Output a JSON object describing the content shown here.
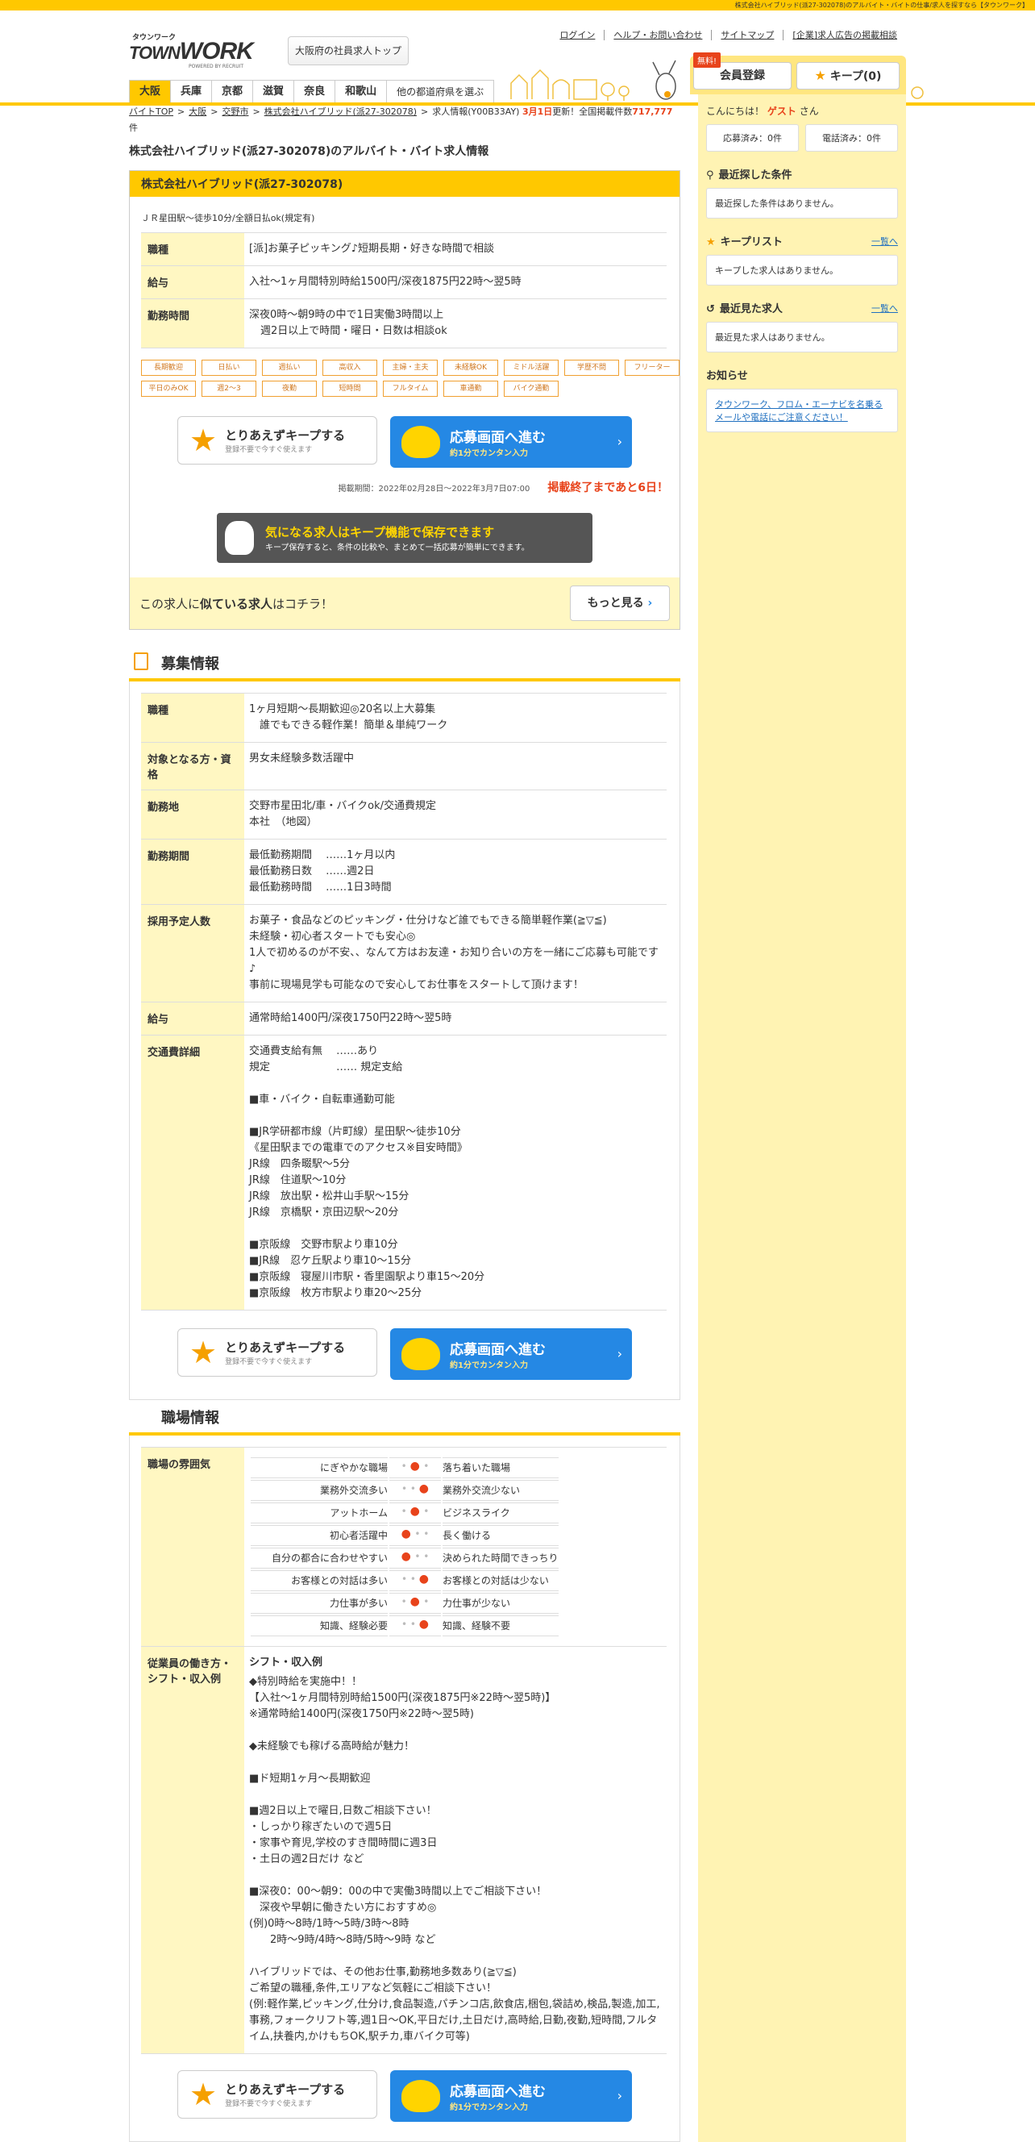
{
  "topbar_text": "株式会社ハイブリッド(派27-302078)のアルバイト・バイトの仕事/求人を探すなら【タウンワーク】",
  "logo": {
    "kana": "タウンワーク",
    "word_town": "TOWN",
    "word_work": "WORK",
    "by": "POWERED BY RECRUIT"
  },
  "osaka_top": "大阪府の社員求人トップ",
  "header_links": [
    "ログイン",
    "ヘルプ・お問い合わせ",
    "サイトマップ",
    "[企業]求人広告の掲載相談"
  ],
  "regions": [
    "大阪",
    "兵庫",
    "京都",
    "滋賀",
    "奈良",
    "和歌山"
  ],
  "regions_other": "他の都道府県を選ぶ",
  "free_badge": "無料!",
  "member_btn": "会員登録",
  "keep_btn": "キープ(0)",
  "breadcrumb": {
    "items": [
      "バイトTOP",
      "大阪",
      "交野市",
      "株式会社ハイブリッド(派27-302078)"
    ],
    "tail": "求人情報(Y00B33AY)",
    "updated": "3月1日",
    "updated_suffix": "更新！全国掲載件数",
    "count": "717,777",
    "count_unit": "件"
  },
  "page_title": "株式会社ハイブリッド(派27-302078)のアルバイト・バイト求人情報",
  "summary": {
    "head": "株式会社ハイブリッド(派27-302078)",
    "note": "ＪＲ星田駅～徒歩10分/全額日払ok(規定有)",
    "rows": [
      {
        "label": "職種",
        "value": "[派]お菓子ピッキング♪短期長期・好きな時間で相談"
      },
      {
        "label": "給与",
        "value": "入社～1ヶ月間特別時給1500円/深夜1875円22時～翌5時"
      },
      {
        "label": "勤務時間",
        "value": "深夜0時～朝9時の中で1日実働3時間以上",
        "value2": "週2日以上で時間・曜日・日数は相談ok"
      }
    ],
    "tags": [
      "長期歓迎",
      "日払い",
      "週払い",
      "高収入",
      "主婦・主夫",
      "未経験OK",
      "ミドル活躍",
      "学歴不問",
      "フリーター",
      "平日のみOK",
      "週2～3",
      "夜勤",
      "短時間",
      "フルタイム",
      "車通勤",
      "バイク通勤"
    ],
    "period": "掲載期間：2022年02月28日～2022年3月7日07:00",
    "deadline": "掲載終了まであと6日！"
  },
  "keep_action": {
    "t1": "とりあえずキープする",
    "t2": "登録不要で今すぐ使えます"
  },
  "apply_action": {
    "t1": "応募画面へ進む",
    "t2": "約1分でカンタン入力"
  },
  "banner": {
    "t1": "気になる求人はキープ機能で保存できます",
    "t2": "キープ保存すると、条件の比較や、まとめて一括応募が簡単にできます。"
  },
  "similar": {
    "pre": "この求人に",
    "bold": "似ている求人",
    "post": "はコチラ！",
    "more": "もっと見る"
  },
  "recruit": {
    "title": "募集情報",
    "rows": [
      {
        "label": "職種",
        "lines": [
          "1ヶ月短期～長期歓迎◎20名以上大募集",
          "　誰でもできる軽作業！簡単＆単純ワーク"
        ]
      },
      {
        "label": "対象となる方・資格",
        "lines": [
          "男女未経験多数活躍中"
        ]
      },
      {
        "label": "勤務地",
        "lines": [
          "交野市星田北/車・バイクok/交通費規定",
          "本社　（地図）"
        ]
      },
      {
        "label": "勤務期間",
        "lines": [
          "最低勤務期間　 ……1ヶ月以内",
          "最低勤務日数　 ……週2日",
          "最低勤務時間　 ……1日3時間"
        ]
      },
      {
        "label": "採用予定人数",
        "lines": [
          "お菓子・食品などのピッキング・仕分けなど誰でもできる簡単軽作業(≧▽≦)",
          "未経験・初心者スタートでも安心◎",
          "1人で初めるのが不安、、なんて方はお友達・お知り合いの方を一緒にご応募も可能です♪",
          "事前に現場見学も可能なので安心してお仕事をスタートして頂けます！"
        ]
      },
      {
        "label": "給与",
        "lines": [
          "通常時給1400円/深夜1750円22時～翌5時"
        ]
      },
      {
        "label": "交通費詳細",
        "lines": [
          "交通費支給有無　 ……あり",
          "規定　　　　　　 …… 規定支給",
          "",
          "■車・バイク・自転車通勤可能",
          "",
          "■JR学研都市線（片町線）星田駅～徒歩10分",
          "《星田駅までの電車でのアクセス※目安時間》",
          "JR線　四条畷駅～5分",
          "JR線　住道駅～10分",
          "JR線　放出駅・松井山手駅～15分",
          "JR線　京橋駅・京田辺駅～20分",
          "",
          "■京阪線　交野市駅より車10分",
          "■JR線　忍ケ丘駅より車10～15分",
          "■京阪線　寝屋川市駅・香里園駅より車15～20分",
          "■京阪線　枚方市駅より車20～25分"
        ]
      }
    ]
  },
  "workplace": {
    "title": "職場情報",
    "atmosphere_label": "職場の雰囲気",
    "atmosphere": [
      {
        "left": "にぎやかな職場",
        "right": "落ち着いた職場",
        "pos": 1
      },
      {
        "left": "業務外交流多い",
        "right": "業務外交流少ない",
        "pos": 2
      },
      {
        "left": "アットホーム",
        "right": "ビジネスライク",
        "pos": 1
      },
      {
        "left": "初心者活躍中",
        "right": "長く働ける",
        "pos": 0
      },
      {
        "left": "自分の都合に合わせやすい",
        "right": "決められた時間できっちり",
        "pos": 0
      },
      {
        "left": "お客様との対話は多い",
        "right": "お客様との対話は少ない",
        "pos": 2
      },
      {
        "left": "力仕事が多い",
        "right": "力仕事が少ない",
        "pos": 1
      },
      {
        "left": "知識、経験必要",
        "right": "知識、経験不要",
        "pos": 2
      }
    ],
    "shift_label": "従業員の働き方・シフト・収入例",
    "shift_title": "シフト・収入例",
    "shift_lines": [
      "◆特別時給を実施中！！",
      "【入社～1ヶ月間特別時給1500円(深夜1875円※22時～翌5時)】",
      "※通常時給1400円(深夜1750円※22時～翌5時)",
      "",
      "◆未経験でも稼げる高時給が魅力！",
      "",
      "■ド短期1ヶ月～長期歓迎",
      "",
      "■週2日以上で曜日,日数ご相談下さい！",
      "・しっかり稼ぎたいので週5日",
      "・家事や育児,学校のすき間時間に週3日",
      "・土日の週2日だけ など",
      "",
      "■深夜0：00～朝9：00の中で実働3時間以上でご相談下さい！",
      "　深夜や早朝に働きたい方におすすめ◎",
      "(例)0時～8時/1時～5時/3時～8時",
      "　　2時～9時/4時～8時/5時～9時 など",
      "",
      "ハイブリッドでは、その他お仕事,勤務地多数あり(≧▽≦)",
      "ご希望の職種,条件,エリアなど気軽にご相談下さい！",
      "(例:軽作業,ピッキング,仕分け,食品製造,パチンコ店,飲食店,梱包,袋詰め,検品,製造,加工,事務,フォークリフト等,週1日～OK,平日だけ,土日だけ,高時給,日勤,夜勤,短時間,フルタイム,扶養内,かけもちOK,駅チカ,車バイク可等)"
    ]
  },
  "side": {
    "greet_pre": "こんにちは！",
    "guest": "ゲスト",
    "greet_post": "さん",
    "applied": "応募済み：0件",
    "called": "電話済み：0件",
    "recent_search_h": "最近探した条件",
    "recent_search_empty": "最近探した条件はありません。",
    "keep_h": "キープリスト",
    "keep_link": "一覧へ",
    "keep_empty": "キープした求人はありません。",
    "recent_view_h": "最近見た求人",
    "recent_view_link": "一覧へ",
    "recent_view_empty": "最近見た求人はありません。",
    "notice_h": "お知らせ",
    "notice_link": "タウンワーク、フロム・エーナビを名乗るメールや電話にご注意ください！"
  }
}
